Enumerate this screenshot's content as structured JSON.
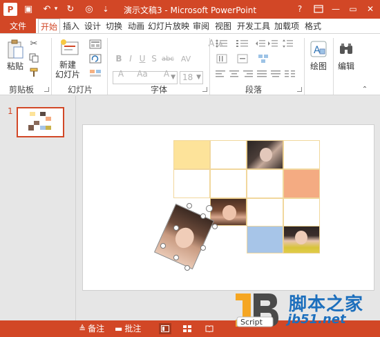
{
  "window": {
    "title": "演示文稿3 - Microsoft PowerPoint",
    "logo_text": "P",
    "help": "?",
    "minimize": "—",
    "restore": "▭",
    "close": "✕"
  },
  "quick_access": {
    "save": "▣",
    "undo": "↶",
    "undo_arrow": "▾",
    "redo": "↻",
    "present": "◎",
    "customize": "⇣"
  },
  "tabs": {
    "file": "文件",
    "items": [
      "开始",
      "插入",
      "设计",
      "切换",
      "动画",
      "幻灯片放映",
      "审阅",
      "视图",
      "开发工具",
      "加载项",
      "格式"
    ],
    "active_index": 0
  },
  "ribbon": {
    "clipboard": {
      "label": "剪贴板",
      "paste": "粘贴",
      "cut_icon": "scissors-icon",
      "copy_icon": "copy-icon",
      "painter_icon": "format-painter-icon"
    },
    "slides": {
      "label": "幻灯片",
      "new_slide_line1": "新建",
      "new_slide_line2": "幻灯片"
    },
    "font": {
      "label": "字体",
      "font_name": "",
      "font_size": "18",
      "bold": "B",
      "italic": "I",
      "underline": "U",
      "strike": "S",
      "shadow": "abc",
      "spacing": "AV",
      "case": "Aa",
      "color": "A",
      "grow": "A",
      "shrink": "A",
      "clear": "A"
    },
    "paragraph": {
      "label": "段落"
    },
    "drawing": {
      "label": "绘图"
    },
    "editing": {
      "label": "编辑"
    }
  },
  "thumbnails": {
    "number": "1"
  },
  "status": {
    "notes": "备注",
    "comments": "批注"
  },
  "colors": {
    "accent": "#d24726",
    "cell_yellow": "#fde39a",
    "cell_orange": "#f4ab82",
    "cell_blue": "#a7c5e8",
    "grid_border": "#f1d79c",
    "watermark": "#1c6fbd"
  },
  "watermark": {
    "main": "脚本之家",
    "site": "jb51.net",
    "script": "Script"
  }
}
